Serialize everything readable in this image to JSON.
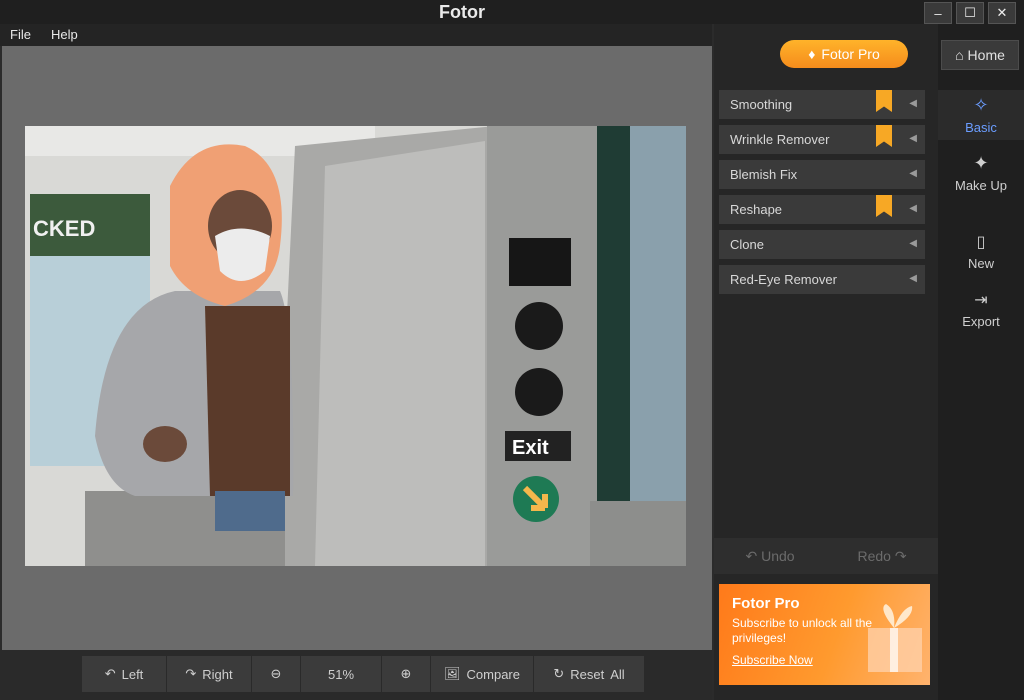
{
  "window": {
    "title": "Fotor",
    "minimize": "–",
    "maximize": "☐",
    "close": "✕"
  },
  "menu": [
    "File",
    "Help"
  ],
  "right_panel": {
    "pro_button": "Fotor Pro",
    "tools": [
      {
        "label": "Smoothing",
        "premium": true
      },
      {
        "label": "Wrinkle Remover",
        "premium": true
      },
      {
        "label": "Blemish Fix",
        "premium": false
      },
      {
        "label": "Reshape",
        "premium": true
      },
      {
        "label": "Clone",
        "premium": false
      },
      {
        "label": "Red-Eye Remover",
        "premium": false
      }
    ],
    "undo": "Undo",
    "redo": "Redo",
    "promo": {
      "title": "Fotor Pro",
      "text": "Subscribe to unlock all the privileges!",
      "link": "Subscribe Now"
    }
  },
  "sidebar": {
    "home": "Home",
    "items": [
      {
        "label": "Basic"
      },
      {
        "label": "Make Up"
      },
      {
        "label": "New"
      },
      {
        "label": "Export"
      }
    ]
  },
  "bottom_toolbar": {
    "left": "Left",
    "right": "Right",
    "zoom": "51%",
    "compare": "Compare",
    "reset": "Reset",
    "all": "All"
  },
  "photo": {
    "sign_exit": "Exit",
    "sign_poster": "CKED"
  },
  "colors": {
    "accent": "#f7a825",
    "active": "#6b9dff",
    "canvas": "#6b6b6b"
  }
}
